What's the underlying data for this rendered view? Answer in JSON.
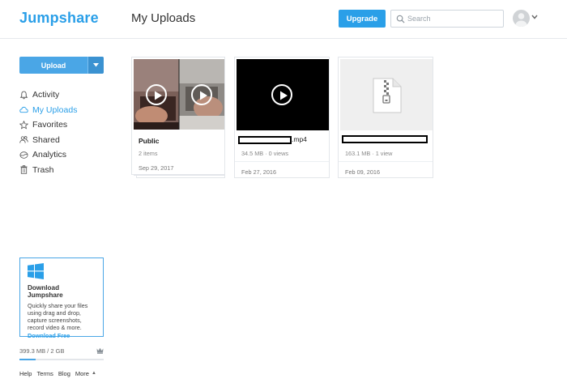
{
  "header": {
    "logo": "Jumpshare",
    "page_title": "My Uploads",
    "upgrade_label": "Upgrade",
    "search_placeholder": "Search"
  },
  "sidebar": {
    "upload_label": "Upload",
    "nav": [
      {
        "label": "Activity",
        "icon": "bell-icon",
        "active": false
      },
      {
        "label": "My Uploads",
        "icon": "cloud-icon",
        "active": true
      },
      {
        "label": "Favorites",
        "icon": "star-icon",
        "active": false
      },
      {
        "label": "Shared",
        "icon": "users-icon",
        "active": false
      },
      {
        "label": "Analytics",
        "icon": "analytics-icon",
        "active": false
      },
      {
        "label": "Trash",
        "icon": "trash-icon",
        "active": false
      }
    ],
    "promo": {
      "title": "Download Jumpshare",
      "text": "Quickly share your files using drag and drop, capture screenshots, record video & more.",
      "link": "Download Free"
    },
    "storage": {
      "text": "399.3 MB / 2 GB",
      "used_fraction": 0.195
    },
    "footer_links": [
      "Help",
      "Terms",
      "Blog",
      "More"
    ]
  },
  "files": [
    {
      "title": "Public",
      "meta": "2 items",
      "date": "Sep 29, 2017",
      "kind": "folder"
    },
    {
      "title_suffix": ".mp4",
      "meta": "34.5 MB · 0 views",
      "date": "Feb 27, 2016",
      "kind": "video"
    },
    {
      "meta": "163.1 MB · 1 view",
      "date": "Feb 09, 2016",
      "kind": "zip"
    }
  ],
  "colors": {
    "accent": "#2a9fe8",
    "upload_button": "#4aa6e6"
  }
}
